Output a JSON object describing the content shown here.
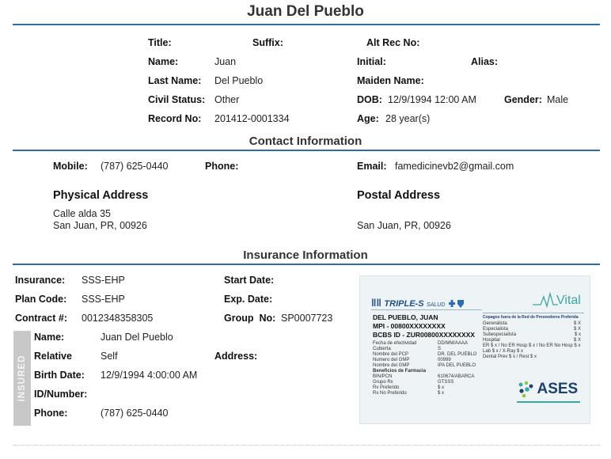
{
  "header": {
    "title": "Juan Del Pueblo"
  },
  "patient": {
    "title_label": "Title:",
    "title_value": "",
    "suffix_label": "Suffix:",
    "suffix_value": "",
    "alt_rec_label": "Alt Rec No:",
    "alt_rec_value": "",
    "name_label": "Name:",
    "name_value": "Juan",
    "initial_label": "Initial:",
    "initial_value": "",
    "alias_label": "Alias:",
    "alias_value": "",
    "last_name_label": "Last Name:",
    "last_name_value": "Del Pueblo",
    "maiden_label": "Maiden Name:",
    "maiden_value": "",
    "civil_label": "Civil Status:",
    "civil_value": "Other",
    "dob_label": "DOB:",
    "dob_value": "12/9/1994 12:00 AM",
    "gender_label": "Gender:",
    "gender_value": "Male",
    "record_label": "Record No:",
    "record_value": "201412-0001334",
    "age_label": "Age:",
    "age_value": "28 year(s)"
  },
  "contact": {
    "section_title": "Contact Information",
    "mobile_label": "Mobile:",
    "mobile_value": "(787) 625-0440",
    "phone_label": "Phone:",
    "phone_value": "",
    "email_label": "Email:",
    "email_value": "famedicinevb2@gmail.com",
    "physical_heading": "Physical Address",
    "physical_line1": "Calle alda 35",
    "physical_line2": "San Juan, PR, 00926",
    "postal_heading": "Postal Address",
    "postal_line1": "San Juan, PR, 00926"
  },
  "insurance": {
    "section_title": "Insurance Information",
    "insurance_label": "Insurance:",
    "insurance_value": "SSS-EHP",
    "plan_label": "Plan Code:",
    "plan_value": "SSS-EHP",
    "contract_label": "Contract #:",
    "contract_value": "0012348358305",
    "start_label": "Start Date:",
    "start_value": "",
    "exp_label": "Exp. Date:",
    "exp_value": "",
    "group_label": "Group  No:",
    "group_value": "SP0007723",
    "insured_tab": "INSURED",
    "ins_name_label": "Name:",
    "ins_name_value": "Juan Del Pueblo",
    "relative_label": "Relative",
    "relative_value": "Self",
    "address_label": "Address:",
    "address_value": "",
    "birth_label": "Birth Date:",
    "birth_value": "12/9/1994 4:00:00 AM",
    "id_label": "ID/Number:",
    "id_value": "",
    "ins_phone_label": "Phone:",
    "ins_phone_value": "(787) 625-0440"
  },
  "card": {
    "brand_left": "TRIPLE-S",
    "brand_left_sub": "SALUD",
    "brand_right": "Vital",
    "member_name": "DEL PUEBLO, JUAN",
    "mpi": "MPI - 00800XXXXXXXX",
    "bcbs": "BCBS ID - ZUR00800XXXXXXXX",
    "fields": [
      {
        "label": "Fecha de efectividad",
        "value": "DD/MM/AAAA"
      },
      {
        "label": "Cubierta",
        "value": "S"
      },
      {
        "label": "Nombre del PCP",
        "value": "DR. DEL PUEBLO"
      },
      {
        "label": "Numero del GMP",
        "value": "00999"
      },
      {
        "label": "Nombre del GMP",
        "value": "IPA DEL PUEBLO"
      }
    ],
    "pharmacy_heading": "Beneficios de Farmacia",
    "pharmacy": [
      {
        "label": "BIN/PCN",
        "value": "610674/ABARCA"
      },
      {
        "label": "Grupo Rx",
        "value": "GTSSS"
      },
      {
        "label": "Rx Preferido",
        "value": "$ x"
      },
      {
        "label": "Rx No Preferido",
        "value": "$ x"
      }
    ],
    "copay_heading": "Copagos fuera de la Red de Proveedores Preferida",
    "copays": [
      {
        "label": "Generalista",
        "value": "$ X"
      },
      {
        "label": "Especialista",
        "value": "$ X"
      },
      {
        "label": "Subespecialista",
        "value": "$ x"
      },
      {
        "label": "Hospital",
        "value": "$ X"
      },
      {
        "label": "ER $ x / No ER Hosp $ x / No ER No Hosp $ x",
        "value": ""
      },
      {
        "label": "Lab $ x / X-Ray $ x",
        "value": ""
      },
      {
        "label": "Dental Prev $ x / Rest $ x",
        "value": ""
      }
    ],
    "logo_ases": "ASES",
    "colors": {
      "triple_s_blue": "#1f4e8c",
      "vital_teal": "#3aa7a3",
      "ases_navy": "#1d3f73"
    }
  }
}
